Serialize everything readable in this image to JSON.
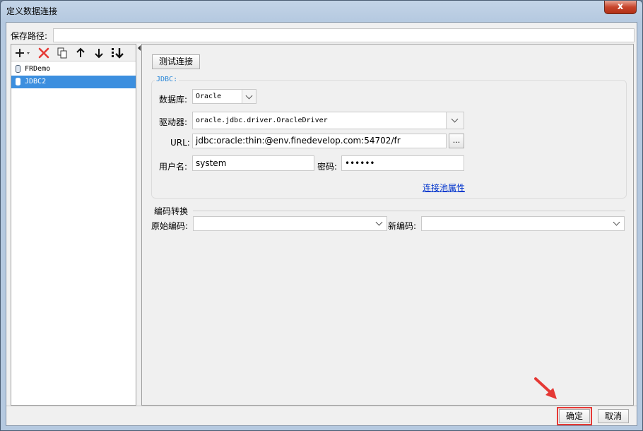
{
  "window": {
    "title": "定义数据连接",
    "close_glyph": "x"
  },
  "save_path": {
    "label": "保存路径:",
    "value": ""
  },
  "toolbar": {
    "icons": [
      "add-icon",
      "delete-icon",
      "copy-icon",
      "move-up-icon",
      "move-down-icon",
      "sort-icon"
    ]
  },
  "connections": [
    {
      "name": "FRDemo",
      "selected": false
    },
    {
      "name": "JDBC2",
      "selected": true
    }
  ],
  "test_button": "测试连接",
  "jdbc": {
    "group_title": "JDBC:",
    "database_label": "数据库:",
    "database_value": "Oracle",
    "driver_label": "驱动器:",
    "driver_value": "oracle.jdbc.driver.OracleDriver",
    "url_label": "URL:",
    "url_value": "jdbc:oracle:thin:@env.finedevelop.com:54702/fr",
    "url_browse": "...",
    "username_label": "用户名:",
    "username_value": "system",
    "password_label": "密码:",
    "password_value": "••••••",
    "pool_link": "连接池属性"
  },
  "encoding": {
    "group_title": "编码转换",
    "original_label": "原始编码:",
    "original_value": "",
    "new_label": "新编码:",
    "new_value": ""
  },
  "footer": {
    "ok": "确定",
    "cancel": "取消"
  },
  "colors": {
    "highlight": "#e53935",
    "selection": "#3c8fdf",
    "link": "#0033cc"
  }
}
